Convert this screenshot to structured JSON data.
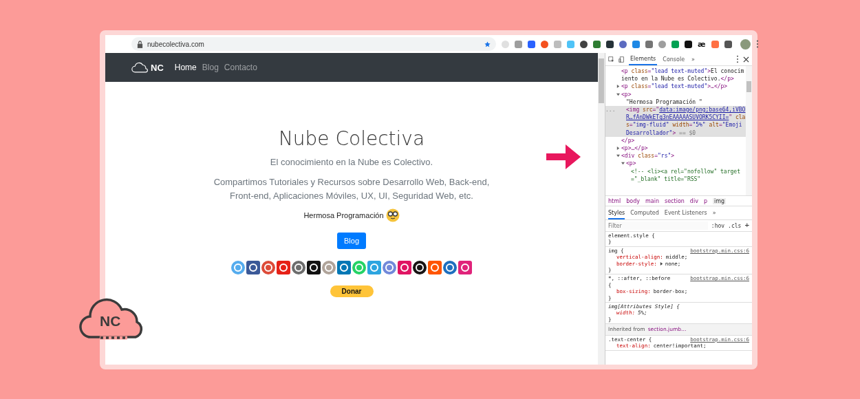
{
  "browser": {
    "url": "nubecolectiva.com",
    "extension_text": "æ"
  },
  "site": {
    "logo_text": "NC",
    "nav": [
      {
        "label": "Home",
        "selected": true
      },
      {
        "label": "Blog",
        "selected": false
      },
      {
        "label": "Contacto",
        "selected": false
      }
    ],
    "title": "Nube Colectiva",
    "subtitle": "El conocimiento en la Nube es Colectivo.",
    "description": "Compartimos Tutoriales y Recursos sobre Desarrollo Web, Back-end, Front-end, Aplicaciones Móviles, UX, UI, Seguridad Web, etc.",
    "tagline": "Hermosa Programación",
    "blog_button": "Blog",
    "donate_button": "Donar"
  },
  "devtools": {
    "tabs": [
      {
        "label": "Elements",
        "selected": true
      },
      {
        "label": "Console",
        "selected": false
      },
      {
        "label": "»",
        "selected": false
      }
    ],
    "dom_tree": [
      {
        "segments": [
          {
            "kind": "tag",
            "text": "<p "
          },
          {
            "kind": "attr",
            "text": "class"
          },
          {
            "kind": "tag",
            "text": "="
          },
          {
            "kind": "val",
            "text": "\"lead text-muted\""
          },
          {
            "kind": "tag",
            "text": ">"
          },
          {
            "kind": "text",
            "text": "El conocimiento en la Nube es Colectivo."
          },
          {
            "kind": "tag",
            "text": "</p>"
          }
        ]
      },
      {
        "expanded": false,
        "segments": [
          {
            "kind": "tag",
            "text": "<p "
          },
          {
            "kind": "attr",
            "text": "class"
          },
          {
            "kind": "tag",
            "text": "="
          },
          {
            "kind": "val",
            "text": "\"lead text-muted\""
          },
          {
            "kind": "tag",
            "text": ">…</p>"
          }
        ]
      },
      {
        "expanded": true,
        "segments": [
          {
            "kind": "tag",
            "text": "<p>"
          }
        ],
        "closing": [
          {
            "kind": "tag",
            "text": "</p>"
          }
        ],
        "children": [
          {
            "segments": [
              {
                "kind": "text",
                "text": "\"Hermosa Programación \""
              }
            ]
          },
          {
            "selected": true,
            "gutter": "...",
            "segments": [
              {
                "kind": "tag",
                "text": "<img "
              },
              {
                "kind": "attr",
                "text": "src"
              },
              {
                "kind": "tag",
                "text": "=\""
              },
              {
                "kind": "link",
                "text": "data:image/png;base64,iVBOR…fAnDWkETg3nEAAAAASUVORK5CYII="
              },
              {
                "kind": "tag",
                "text": "\" "
              },
              {
                "kind": "attr",
                "text": "clas"
              },
              {
                "kind": "tag",
                "text": "="
              },
              {
                "kind": "val",
                "text": "\"img-fluid\" "
              },
              {
                "kind": "attr",
                "text": "width"
              },
              {
                "kind": "tag",
                "text": "="
              },
              {
                "kind": "val",
                "text": "\"5%\" "
              },
              {
                "kind": "attr",
                "text": "alt"
              },
              {
                "kind": "tag",
                "text": "="
              },
              {
                "kind": "val",
                "text": "\"Emoji Desarrollador\""
              },
              {
                "kind": "tag",
                "text": ">"
              },
              {
                "kind": "hint",
                "text": " == $0"
              }
            ]
          }
        ]
      },
      {
        "expanded": false,
        "segments": [
          {
            "kind": "tag",
            "text": "<p>…</p>"
          }
        ]
      },
      {
        "expanded": true,
        "segments": [
          {
            "kind": "tag",
            "text": "<div "
          },
          {
            "kind": "attr",
            "text": "class"
          },
          {
            "kind": "tag",
            "text": "="
          },
          {
            "kind": "val",
            "text": "\"rs\""
          },
          {
            "kind": "tag",
            "text": ">"
          }
        ],
        "children": [
          {
            "expanded": true,
            "segments": [
              {
                "kind": "tag",
                "text": "<p>"
              }
            ],
            "children": [
              {
                "segments": [
                  {
                    "kind": "comment",
                    "text": "<!-- <li><a rel=\"nofollow\" target=\"_blank\" title=\"RSS\""
                  }
                ]
              }
            ]
          }
        ]
      }
    ],
    "breadcrumbs": [
      {
        "label": "html",
        "selected": false
      },
      {
        "label": "body",
        "selected": false
      },
      {
        "label": "main",
        "selected": false
      },
      {
        "label": "section",
        "selected": false
      },
      {
        "label": "div",
        "selected": false
      },
      {
        "label": "p",
        "selected": false
      },
      {
        "label": "img",
        "selected": true
      }
    ],
    "style_tabs": [
      {
        "label": "Styles",
        "selected": true
      },
      {
        "label": "Computed",
        "selected": false
      },
      {
        "label": "Event Listeners",
        "selected": false
      },
      {
        "label": "»",
        "selected": false
      }
    ],
    "filter": {
      "placeholder": "Filter",
      "hov": ":hov",
      "cls": ".cls",
      "add": "+"
    },
    "rules": [
      {
        "kind": "rule",
        "selector": "element.style {",
        "close": "}"
      },
      {
        "kind": "rule",
        "selector": "img {",
        "source": "bootstrap.min.css:6",
        "close": "}",
        "declarations": [
          {
            "prop": "vertical-align:",
            "value": "middle;"
          },
          {
            "prop": "border-style:",
            "value": "none;",
            "expandable": true
          }
        ]
      },
      {
        "kind": "rule",
        "selector": "*, ::after, ::before",
        "source": "bootstrap.min.css:6",
        "open": "{",
        "close": "}",
        "declarations": [
          {
            "prop": "box-sizing:",
            "value": "border-box;"
          }
        ]
      },
      {
        "kind": "attribute-rule",
        "selector": "img[Attributes Style] {",
        "close": "}",
        "declarations": [
          {
            "prop": "width:",
            "value": "5%;"
          }
        ]
      },
      {
        "kind": "inherited",
        "label": "Inherited from",
        "selector": "section.jumb…"
      },
      {
        "kind": "rule",
        "selector": ".text-center {",
        "source": "bootstrap.min.css:6",
        "declarations": [
          {
            "prop": "text-align:",
            "value": "center!important;"
          }
        ]
      }
    ]
  },
  "badge": {
    "text": "NC"
  }
}
